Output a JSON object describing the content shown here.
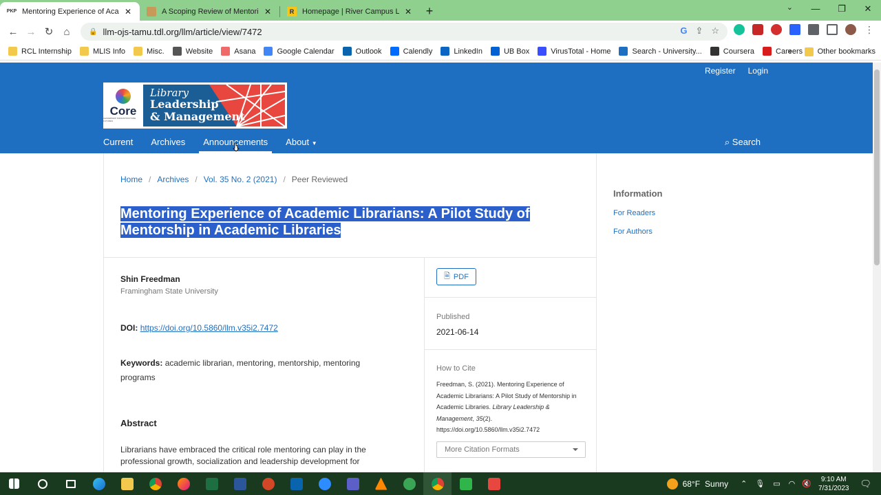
{
  "browser": {
    "tabs": [
      {
        "favicon": "PKP",
        "title": "Mentoring Experience of Academ",
        "active": true
      },
      {
        "favicon": "",
        "title": "A Scoping Review of Mentoring P",
        "active": false
      },
      {
        "favicon": "R",
        "title": "Homepage | River Campus Librari",
        "active": false
      }
    ],
    "new_tab": "+",
    "url": "llm-ojs-tamu.tdl.org/llm/article/view/7472",
    "bookmarks": [
      {
        "label": "RCL Internship",
        "icon": "folder",
        "color": "#f2c94c"
      },
      {
        "label": "MLIS Info",
        "icon": "folder",
        "color": "#f2c94c"
      },
      {
        "label": "Misc.",
        "icon": "folder",
        "color": "#f2c94c"
      },
      {
        "label": "Website",
        "icon": "website-icon",
        "color": "#555555"
      },
      {
        "label": "Asana",
        "icon": "asana-icon",
        "color": "#f06a6a"
      },
      {
        "label": "Google Calendar",
        "icon": "calendar-icon",
        "color": "#4285f4"
      },
      {
        "label": "Outlook",
        "icon": "outlook-icon",
        "color": "#0a64ad"
      },
      {
        "label": "Calendly",
        "icon": "calendly-icon",
        "color": "#006bff"
      },
      {
        "label": "LinkedIn",
        "icon": "linkedin-icon",
        "color": "#0a66c2"
      },
      {
        "label": "UB Box",
        "icon": "box-icon",
        "color": "#0061d5"
      },
      {
        "label": "VirusTotal - Home",
        "icon": "virustotal-icon",
        "color": "#394eff"
      },
      {
        "label": "Search - University...",
        "icon": "university-icon",
        "color": "#1e6fc2"
      },
      {
        "label": "Coursera",
        "icon": "coursera-icon",
        "color": "#333333"
      },
      {
        "label": "Careers",
        "icon": "careers-icon",
        "color": "#d81b1b"
      }
    ],
    "bookmarks_overflow": "»",
    "other_bookmarks": "Other bookmarks"
  },
  "site": {
    "user_links": {
      "register": "Register",
      "login": "Login"
    },
    "logo": {
      "core": "Core",
      "core_sub": "LEADERSHIP INFRASTRUCTURE FUTURES",
      "line1": "Library",
      "line2": "Leadership",
      "line3": "& Management"
    },
    "nav": [
      {
        "label": "Current"
      },
      {
        "label": "Archives"
      },
      {
        "label": "Announcements"
      },
      {
        "label": "About"
      }
    ],
    "search": "Search"
  },
  "article": {
    "breadcrumb": [
      "Home",
      "Archives",
      "Vol. 35 No. 2 (2021)",
      "Peer Reviewed"
    ],
    "title": "Mentoring Experience of Academic Librarians: A Pilot Study of Mentorship in Academic Libraries",
    "author": "Shin Freedman",
    "affiliation": "Framingham State University",
    "doi_label": "DOI:",
    "doi_url": "https://doi.org/10.5860/llm.v35i2.7472",
    "keywords_label": "Keywords:",
    "keywords": "academic librarian, mentoring, mentorship, mentoring programs",
    "abstract_heading": "Abstract",
    "abstract_text": "Librarians have embraced the critical role mentoring can play in the professional growth, socialization and leadership development for",
    "pdf": "PDF",
    "published_label": "Published",
    "published_date": "2021-06-14",
    "cite_label": "How to Cite",
    "cite_plain": "Freedman, S. (2021). Mentoring Experience of Academic Librarians: A Pilot Study of Mentorship in Academic Libraries. ",
    "cite_journal": "Library Leadership & Management",
    "cite_vol": "35",
    "cite_issue": "(2).",
    "cite_doi": "https://doi.org/10.5860/llm.v35i2.7472",
    "cite_formats": "More Citation Formats"
  },
  "sidebar": {
    "title": "Information",
    "links": [
      "For Readers",
      "For Authors"
    ]
  },
  "taskbar": {
    "weather_temp": "68°F",
    "weather_cond": "Sunny",
    "time": "9:10 AM",
    "date": "7/31/2023"
  }
}
